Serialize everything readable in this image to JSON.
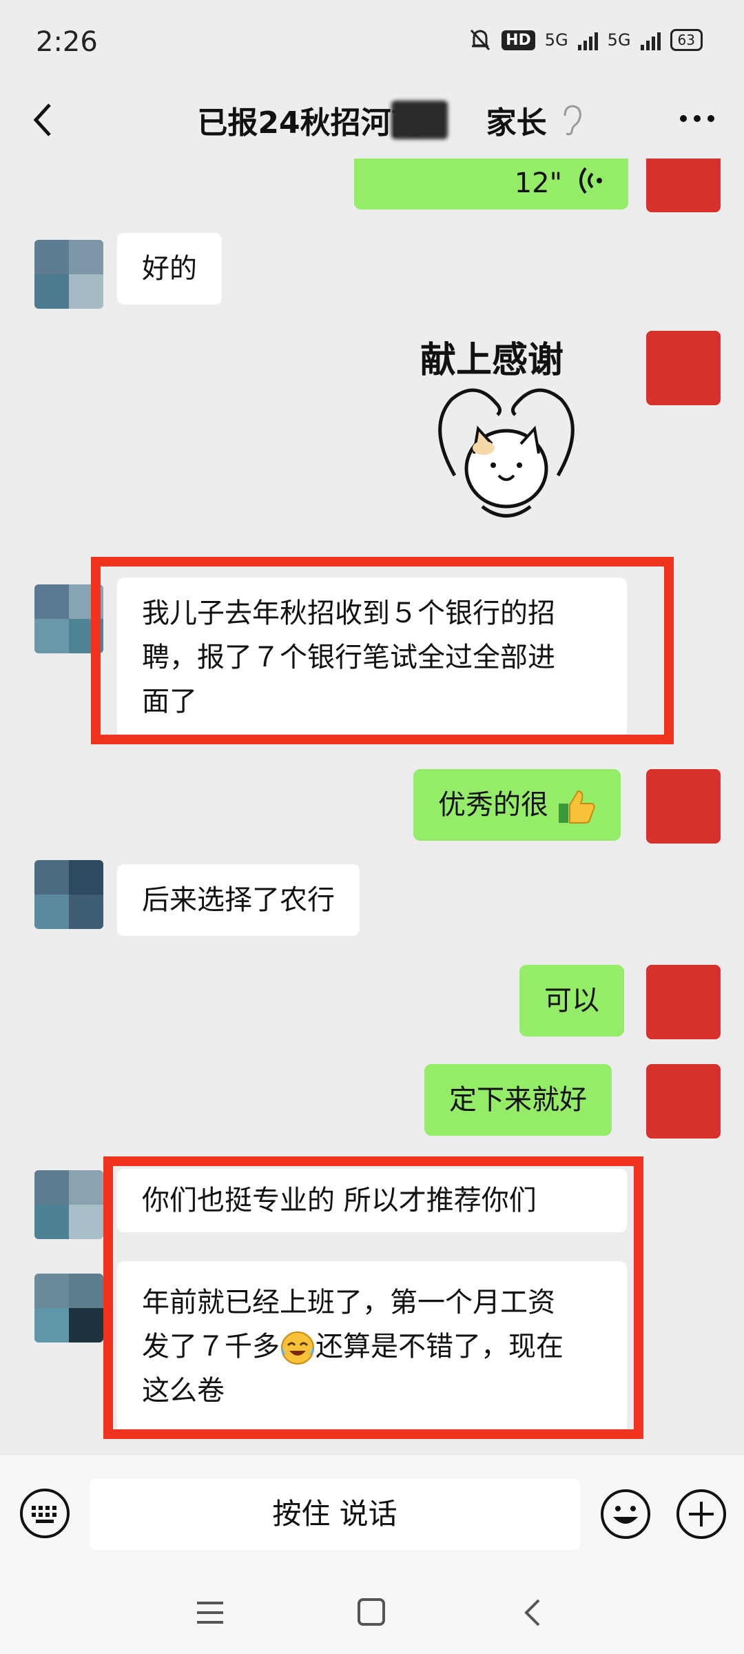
{
  "status": {
    "time": "2:26",
    "hd_badge": "HD",
    "net1": "5G",
    "net2": "5G",
    "battery": "63"
  },
  "header": {
    "title_left": "已报24秋招河南",
    "title_right": "家长"
  },
  "messages": {
    "m1_voice": "12\"",
    "m2": "好的",
    "m3_sticker": "献上感谢",
    "m4_l1": "我儿子去年秋招收到５个银行的招",
    "m4_l2": "聘，报了７个银行笔试全过全部进",
    "m4_l3": "面了",
    "m5": "优秀的很",
    "m6": "后来选择了农行",
    "m7": "可以",
    "m8": "定下来就好",
    "m9": "你们也挺专业的 所以才推荐你们",
    "m10_l1": "年前就已经上班了，第一个月工资",
    "m10_l2a": "发了７千多",
    "m10_l2b": "还算是不错了，现在",
    "m10_l3": "这么卷"
  },
  "input": {
    "voice_label": "按住 说话"
  },
  "colors": {
    "outgoing_bubble": "#95ec69",
    "highlight_box": "#f0321e",
    "background": "#ededed"
  }
}
